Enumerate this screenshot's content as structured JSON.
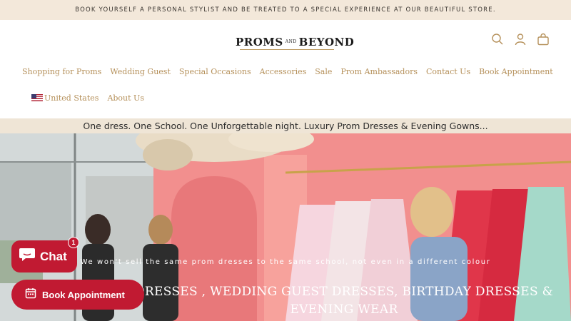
{
  "announcement": "BOOK YOURSELF A PERSONAL STYLIST AND BE TREATED TO A SPECIAL EXPERIENCE AT OUR BEAUTIFUL STORE.",
  "logo": {
    "left": "PROMS",
    "and": "AND",
    "right": "BEYOND"
  },
  "header_icons": [
    "search-icon",
    "account-icon",
    "cart-icon"
  ],
  "nav": {
    "row1": [
      "Shopping for Proms",
      "Wedding Guest",
      "Special Occasions",
      "Accessories",
      "Sale",
      "Prom Ambassadors",
      "Contact Us",
      "Book Appointment"
    ],
    "country": "United States",
    "about": "About Us"
  },
  "tagline": "One dress. One School. One Unforgettable night. Luxury Prom Dresses & Evening Gowns...",
  "hero": {
    "subtitle": "We won't sell the same prom dresses to the same school, not even in a different colour",
    "title": "DRESSES , WEDDING GUEST DRESSES, BIRTHDAY DRESSES & EVENING WEAR"
  },
  "chat": {
    "label": "Chat",
    "badge": "1"
  },
  "book_button": {
    "label": "Book Appointment"
  },
  "colors": {
    "accent": "#b5905a",
    "brand_red": "#c11a32",
    "cream": "#f3e8da"
  }
}
